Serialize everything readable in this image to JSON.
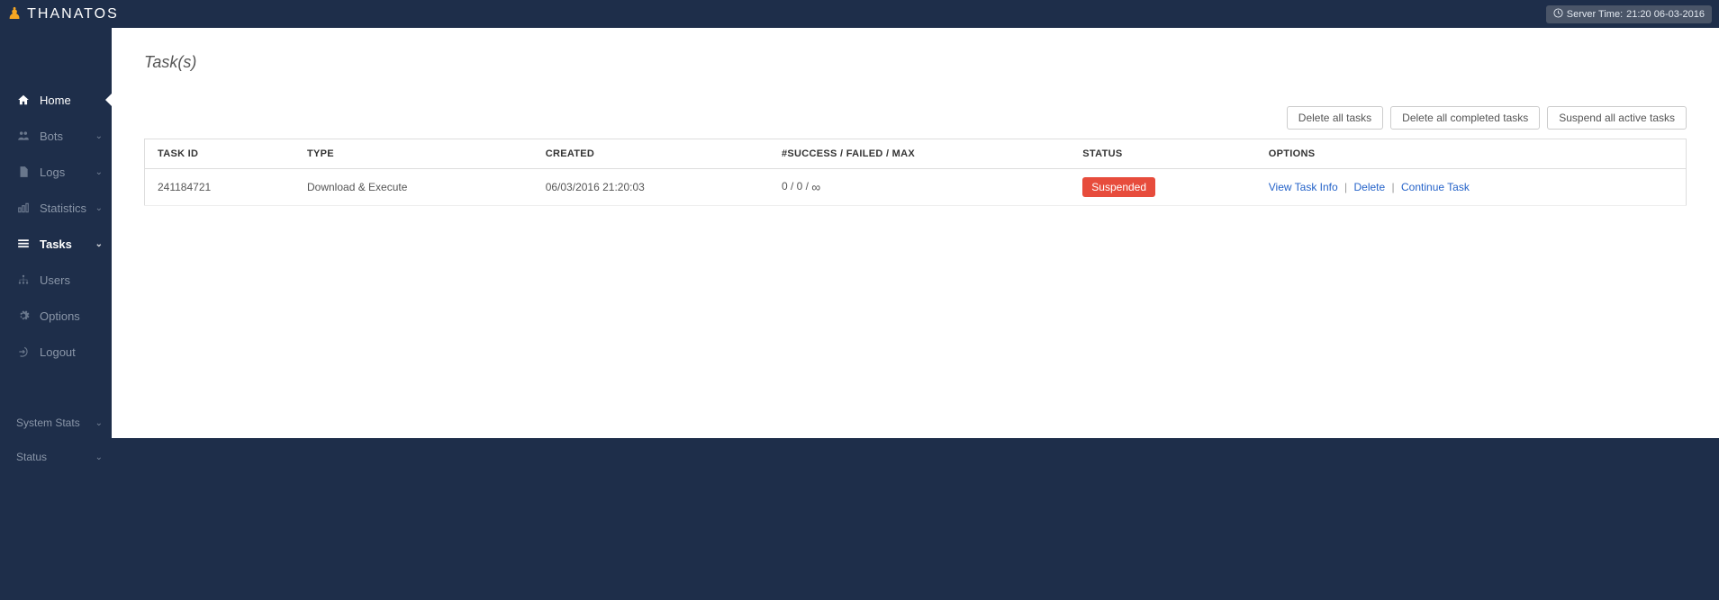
{
  "header": {
    "logo_text": "THANATOS",
    "server_time_label": "Server Time:",
    "server_time_value": "21:20 06-03-2016"
  },
  "sidebar": {
    "items": [
      {
        "label": "Home",
        "icon": "home",
        "expandable": false,
        "active_pointer": true
      },
      {
        "label": "Bots",
        "icon": "users",
        "expandable": true
      },
      {
        "label": "Logs",
        "icon": "file",
        "expandable": true
      },
      {
        "label": "Statistics",
        "icon": "chart",
        "expandable": true
      },
      {
        "label": "Tasks",
        "icon": "tasks",
        "expandable": true,
        "section_active": true
      },
      {
        "label": "Users",
        "icon": "sitemap",
        "expandable": false
      },
      {
        "label": "Options",
        "icon": "gear",
        "expandable": false
      },
      {
        "label": "Logout",
        "icon": "logout",
        "expandable": false
      }
    ],
    "footer": [
      {
        "label": "System Stats",
        "expandable": true
      },
      {
        "label": "Status",
        "expandable": true
      }
    ]
  },
  "page": {
    "title": "Task(s)"
  },
  "actions": {
    "delete_all": "Delete all tasks",
    "delete_completed": "Delete all completed tasks",
    "suspend_active": "Suspend all active tasks"
  },
  "table": {
    "columns": {
      "task_id": "TASK ID",
      "type": "TYPE",
      "created": "CREATED",
      "counts": "#SUCCESS / FAILED / MAX",
      "status": "STATUS",
      "options": "OPTIONS"
    },
    "rows": [
      {
        "task_id": "241184721",
        "type": "Download & Execute",
        "created": "06/03/2016 21:20:03",
        "counts": "0 / 0 / ",
        "counts_suffix": "∞",
        "status": "Suspended",
        "options": {
          "view": "View Task Info",
          "delete": "Delete",
          "continue": "Continue Task"
        }
      }
    ]
  }
}
